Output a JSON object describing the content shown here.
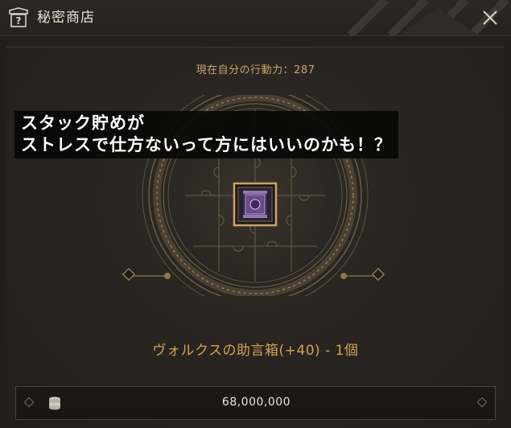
{
  "window": {
    "title": "秘密商店",
    "shop_icon_glyph": "?"
  },
  "shop": {
    "action_power_label": "現在自分の行動力：287",
    "item_name": "ヴォルクスの助言箱(+40) - 1個",
    "price": "68,000,000"
  },
  "overlay": {
    "line1": "スタック貯めが",
    "line2": "ストレスで仕方ないって方にはいいのかも！？"
  },
  "colors": {
    "accent_gold": "#c9a56a",
    "item_name_gold": "#d4a14e",
    "emblem_gold": "#8a7550"
  },
  "icons": {
    "shop": "shop-question-icon",
    "close": "close-icon",
    "coin": "coin-stack-icon",
    "item": "scroll-box-icon"
  }
}
